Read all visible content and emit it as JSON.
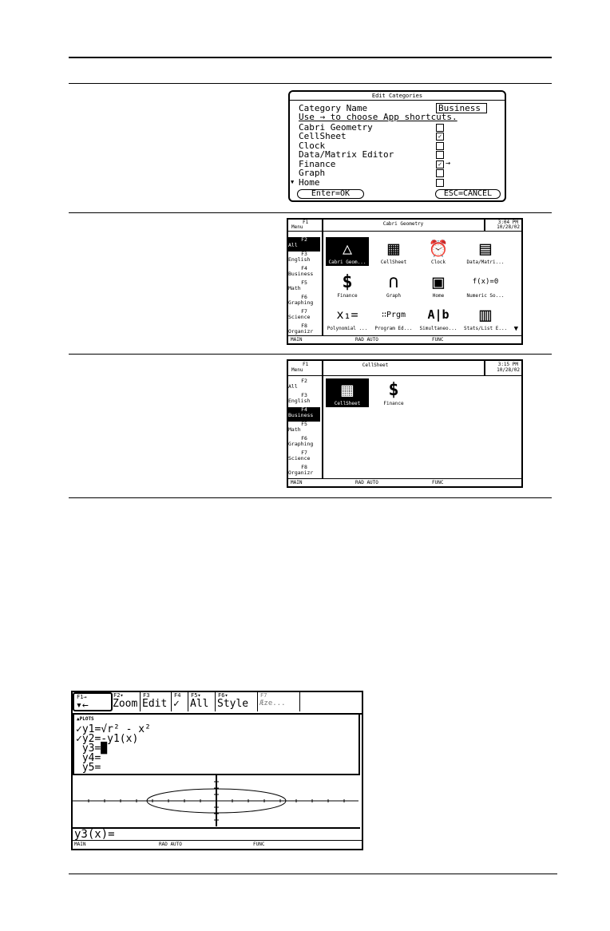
{
  "dialog": {
    "title": "Edit Categories",
    "category_name_label": "Category Name",
    "category_name_value": "Business",
    "instruction": "Use → to choose App shortcuts.",
    "items": [
      {
        "label": "Cabri Geometry",
        "mark": ""
      },
      {
        "label": "CellSheet",
        "mark": "✓"
      },
      {
        "label": "Clock",
        "mark": ""
      },
      {
        "label": "Data/Matrix Editor",
        "mark": ""
      },
      {
        "label": "Finance",
        "mark": "✓"
      },
      {
        "label": "Graph",
        "mark": ""
      },
      {
        "label": "Home",
        "mark": ""
      }
    ],
    "cursor_arrow": "→",
    "more_arrow": "▼",
    "enter_label": "Enter=OK",
    "esc_label": "ESC=CANCEL"
  },
  "desktop_all": {
    "f1": "F1",
    "menu": "Menu",
    "title": "Cabri Geometry",
    "time": "3:04 PM",
    "date": "10/28/02",
    "categories": [
      {
        "fk": "F2",
        "label": "All"
      },
      {
        "fk": "F3",
        "label": "English"
      },
      {
        "fk": "F4",
        "label": "Business"
      },
      {
        "fk": "F5",
        "label": "Math"
      },
      {
        "fk": "F6",
        "label": "Graphing"
      },
      {
        "fk": "F7",
        "label": "Science"
      },
      {
        "fk": "F8",
        "label": "Organizr"
      }
    ],
    "apps": [
      {
        "label": "Cabri Geom...",
        "icon": "cabri-icon",
        "glyph": "△"
      },
      {
        "label": "CellSheet",
        "icon": "cellsheet-icon",
        "glyph": "▦"
      },
      {
        "label": "Clock",
        "icon": "clock-icon",
        "glyph": "⏰"
      },
      {
        "label": "Data/Matri...",
        "icon": "data-matrix-icon",
        "glyph": "▤"
      },
      {
        "label": "Finance",
        "icon": "finance-icon",
        "glyph": "$"
      },
      {
        "label": "Graph",
        "icon": "graph-icon",
        "glyph": "∩"
      },
      {
        "label": "Home",
        "icon": "home-icon",
        "glyph": "▣"
      },
      {
        "label": "Numeric So...",
        "icon": "numeric-solver-icon",
        "glyph": "f(x)=0"
      },
      {
        "label": "Polynomial ...",
        "icon": "polynomial-icon",
        "glyph": "x₁="
      },
      {
        "label": "Program Ed...",
        "icon": "program-editor-icon",
        "glyph": "∷Prgm"
      },
      {
        "label": "Simultaneo...",
        "icon": "simultaneous-icon",
        "glyph": "A|b"
      },
      {
        "label": "Stats/List E...",
        "icon": "stats-list-icon",
        "glyph": "▥"
      }
    ],
    "scroll_arrow": "▼",
    "status_main": "MAIN",
    "status_mode": "RAD AUTO",
    "status_func": "FUNC"
  },
  "desktop_business": {
    "f1": "F1",
    "menu": "Menu",
    "title": "CellSheet",
    "time": "3:15 PM",
    "date": "10/28/02",
    "categories": [
      {
        "fk": "F2",
        "label": "All"
      },
      {
        "fk": "F3",
        "label": "English"
      },
      {
        "fk": "F4",
        "label": "Business"
      },
      {
        "fk": "F5",
        "label": "Math"
      },
      {
        "fk": "F6",
        "label": "Graphing"
      },
      {
        "fk": "F7",
        "label": "Science"
      },
      {
        "fk": "F8",
        "label": "Organizr"
      }
    ],
    "apps": [
      {
        "label": "CellSheet",
        "icon": "cellsheet-icon",
        "glyph": "▦"
      },
      {
        "label": "Finance",
        "icon": "finance-icon",
        "glyph": "$"
      }
    ],
    "status_main": "MAIN",
    "status_mode": "RAD AUTO",
    "status_func": "FUNC"
  },
  "yeditor": {
    "toolbar": [
      {
        "fk": "F1→",
        "label": "▾←"
      },
      {
        "fk": "F2▾",
        "label": "Zoom"
      },
      {
        "fk": "F3",
        "label": "Edit"
      },
      {
        "fk": "F4",
        "label": "✓"
      },
      {
        "fk": "F5▾",
        "label": "All"
      },
      {
        "fk": "F6▾",
        "label": "Style"
      },
      {
        "fk": "F7",
        "label": "Æze..."
      }
    ],
    "plots_label": "▲PLOTS",
    "lines": [
      "✓y1=√r² - x²",
      "✓y2=-y1(x)",
      " y3=█",
      " y4=",
      " y5="
    ],
    "entry": "y3(x)=",
    "status_main": "MAIN",
    "status_mode": "RAD AUTO",
    "status_func": "FUNC"
  }
}
